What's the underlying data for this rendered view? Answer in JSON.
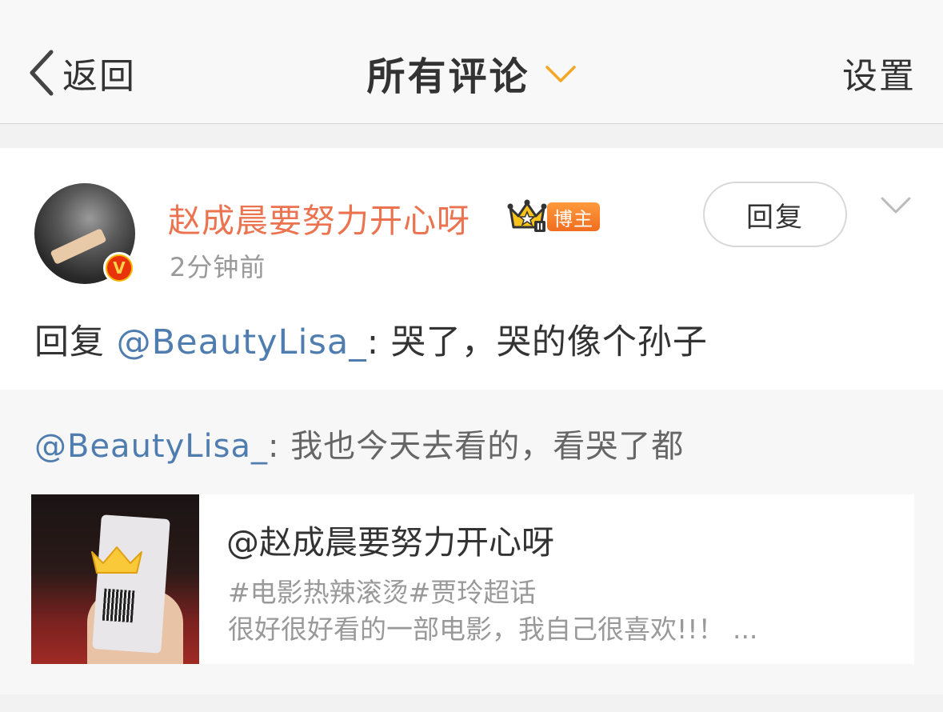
{
  "header": {
    "back_label": "返回",
    "title": "所有评论",
    "settings_label": "设置"
  },
  "comment": {
    "username": "赵成晨要努力开心呀",
    "badge_label": "博主",
    "time": "2分钟前",
    "reply_button": "回复",
    "text_prefix": "回复 ",
    "text_mention": "@BeautyLisa_",
    "text_body": ": 哭了，哭的像个孙子"
  },
  "quote": {
    "mention": "@BeautyLisa_",
    "body": ": 我也今天去看的，看哭了都",
    "embed": {
      "title": "@赵成晨要努力开心呀",
      "tags": "#电影热辣滚烫#贾玲超话",
      "description": "很好很好看的一部电影，我自己很喜欢!!！ ..."
    }
  },
  "colors": {
    "username": "#eb7350",
    "mention": "#507daf",
    "accent_chevron": "#f5a623"
  },
  "icons": {
    "back": "chevron-left-icon",
    "title_dropdown": "chevron-down-icon",
    "more": "chevron-down-icon",
    "verified": "verified-v-icon",
    "crown": "crown-icon"
  }
}
